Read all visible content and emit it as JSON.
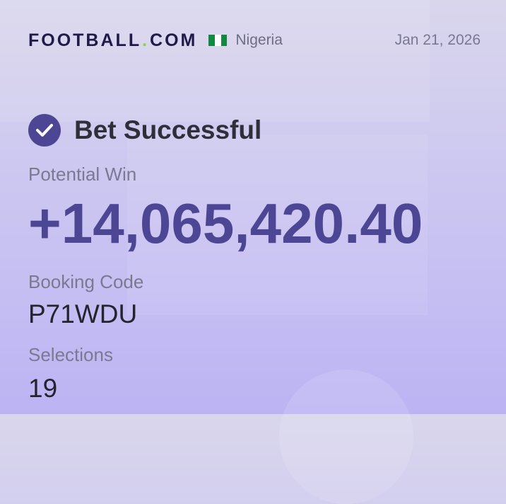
{
  "header": {
    "brand_main": "FOOTBALL",
    "brand_dot": ".",
    "brand_suffix": "COM",
    "country": "Nigeria",
    "date": "Jan 21, 2026"
  },
  "status": {
    "icon": "check-circle-icon",
    "title": "Bet Successful"
  },
  "details": {
    "potential_win_label": "Potential Win",
    "potential_win_value": "+14,065,420.40",
    "booking_code_label": "Booking Code",
    "booking_code_value": "P71WDU",
    "selections_label": "Selections",
    "selections_value": "19"
  },
  "colors": {
    "accent": "#4d4694",
    "brand_dot": "#8fd14f",
    "flag_green": "#0f8a3e"
  }
}
